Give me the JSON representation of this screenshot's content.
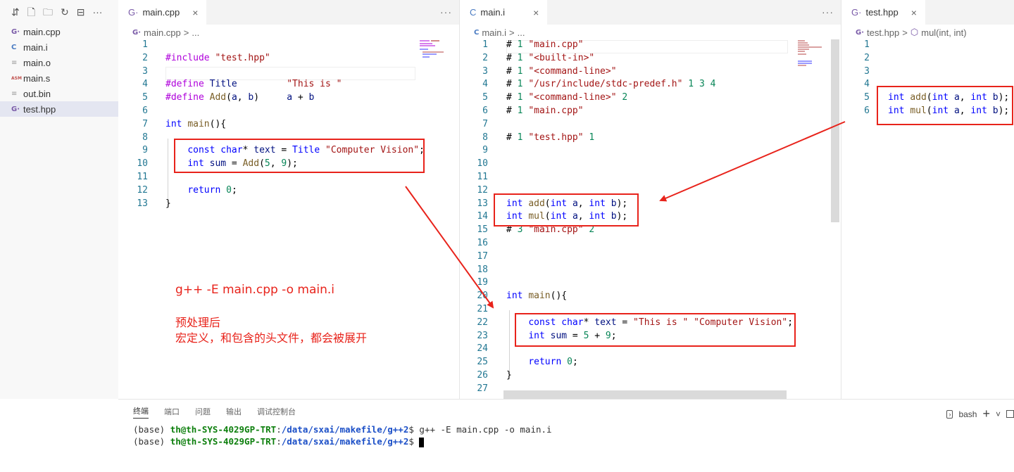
{
  "sidebar": {
    "toolbar_icons": [
      "collapse-icon",
      "new-file-icon",
      "new-folder-icon",
      "refresh-icon",
      "collapse-all-icon",
      "more-icon"
    ],
    "toolbar_glyphs": [
      "⇵",
      "🗋",
      "🗀",
      "↻",
      "⊟",
      "···"
    ],
    "files": [
      {
        "name": "main.cpp",
        "type_label": "G·"
      },
      {
        "name": "main.i",
        "type_label": "C"
      },
      {
        "name": "main.o",
        "type_label": "≡"
      },
      {
        "name": "main.s",
        "type_label": "ASM"
      },
      {
        "name": "out.bin",
        "type_label": "≡"
      },
      {
        "name": "test.hpp",
        "type_label": "G·"
      }
    ]
  },
  "editor1": {
    "tab": {
      "label": "main.cpp",
      "icon": "G·",
      "close": "×"
    },
    "more": "···",
    "breadcrumb": {
      "file": "main.cpp",
      "sep": ">",
      "rest": "..."
    },
    "line_numbers": [
      "1",
      "2",
      "3",
      "4",
      "5",
      "6",
      "7",
      "8",
      "9",
      "10",
      "11",
      "12",
      "13"
    ]
  },
  "editor2": {
    "tab": {
      "label": "main.i",
      "icon": "C",
      "close": "×"
    },
    "more": "···",
    "breadcrumb": {
      "file": "main.i",
      "sep": ">",
      "rest": "..."
    },
    "line_numbers": [
      "1",
      "2",
      "3",
      "4",
      "5",
      "6",
      "7",
      "8",
      "9",
      "10",
      "11",
      "12",
      "13",
      "14",
      "15",
      "16",
      "17",
      "18",
      "19",
      "20",
      "21",
      "22",
      "23",
      "24",
      "25",
      "26",
      "27"
    ]
  },
  "editor3": {
    "tab": {
      "label": "test.hpp",
      "icon": "G·",
      "close": "×"
    },
    "breadcrumb": {
      "file": "test.hpp",
      "sep": ">",
      "symbol": "mul(int, int)"
    },
    "line_numbers": [
      "1",
      "2",
      "3",
      "4",
      "5",
      "6"
    ]
  },
  "annotations": {
    "command": "g++ -E main.cpp -o main.i",
    "note_line1": "预处理后",
    "note_line2": "宏定义，和包含的头文件，都会被展开"
  },
  "panel": {
    "tabs": [
      "终端",
      "端口",
      "问题",
      "输出",
      "调试控制台"
    ],
    "shell": "bash",
    "plus": "+",
    "chevron": "˅",
    "terminal": {
      "prefix": "(base)",
      "user_host": "th@th-SYS-4029GP-TRT",
      "colon": ":",
      "path": "/data/sxai/makefile/g++2",
      "prompt": "$",
      "command": "g++ -E main.cpp -o main.i"
    }
  },
  "colors": {
    "annotation_red": "#e8231b",
    "keyword_blue": "#0000ff",
    "string_red": "#a31515",
    "number_green": "#098658",
    "preprocessor_purple": "#af00db",
    "line_number": "#237893"
  }
}
